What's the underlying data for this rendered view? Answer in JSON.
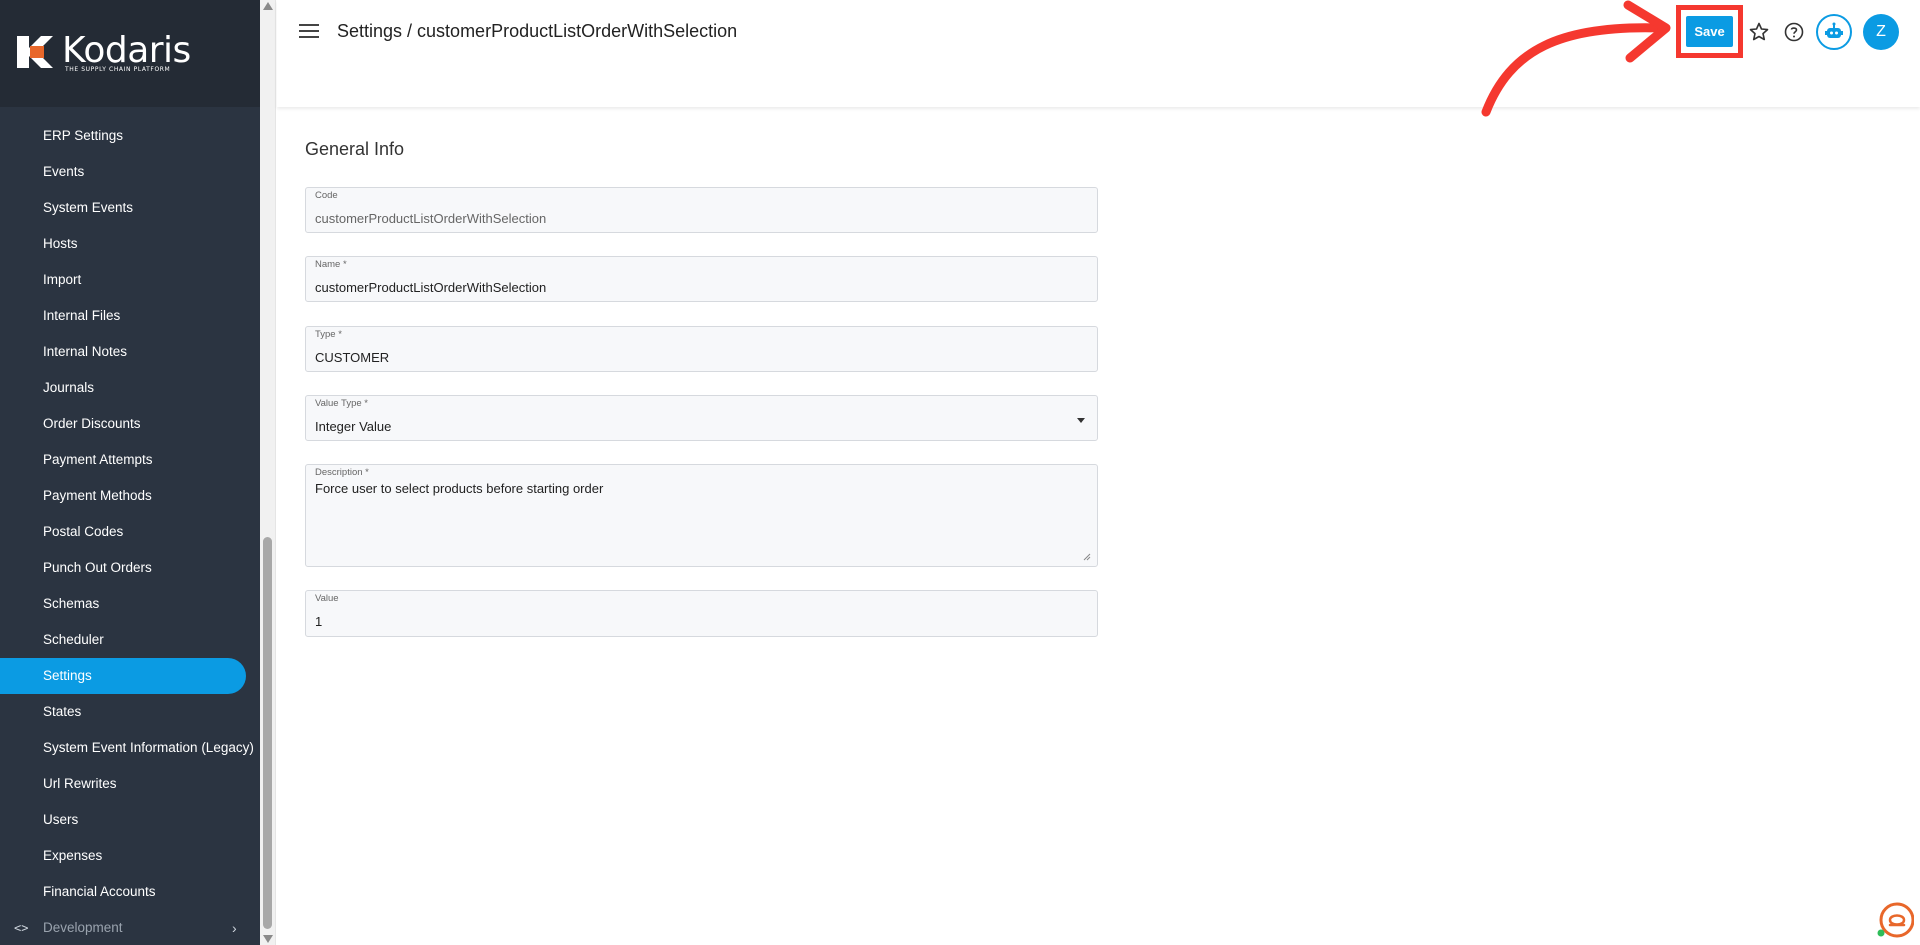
{
  "app": {
    "logo_text": "Kodaris",
    "logo_tagline": "THE SUPPLY CHAIN PLATFORM"
  },
  "sidebar": {
    "items": [
      {
        "label": "ERP Settings"
      },
      {
        "label": "Events"
      },
      {
        "label": "System Events"
      },
      {
        "label": "Hosts"
      },
      {
        "label": "Import"
      },
      {
        "label": "Internal Files"
      },
      {
        "label": "Internal Notes"
      },
      {
        "label": "Journals"
      },
      {
        "label": "Order Discounts"
      },
      {
        "label": "Payment Attempts"
      },
      {
        "label": "Payment Methods"
      },
      {
        "label": "Postal Codes"
      },
      {
        "label": "Punch Out Orders"
      },
      {
        "label": "Schemas"
      },
      {
        "label": "Scheduler"
      },
      {
        "label": "Settings"
      },
      {
        "label": "States"
      },
      {
        "label": "System Event Information (Legacy)"
      },
      {
        "label": "Url Rewrites"
      },
      {
        "label": "Users"
      },
      {
        "label": "Expenses"
      },
      {
        "label": "Financial Accounts"
      }
    ],
    "active_item": "Settings",
    "dev_section": {
      "label": "Development",
      "icon": "code-icon"
    }
  },
  "header": {
    "title": "Settings / customerProductListOrderWithSelection",
    "save_label": "Save",
    "avatar_initial": "Z"
  },
  "form": {
    "section_title": "General Info",
    "code": {
      "label": "Code",
      "value": "customerProductListOrderWithSelection"
    },
    "name": {
      "label": "Name *",
      "value": "customerProductListOrderWithSelection"
    },
    "type": {
      "label": "Type *",
      "value": "CUSTOMER"
    },
    "value_type": {
      "label": "Value Type *",
      "value": "Integer Value"
    },
    "description": {
      "label": "Description *",
      "value": "Force user to select products before starting order"
    },
    "value": {
      "label": "Value",
      "value": "1"
    }
  },
  "colors": {
    "accent": "#0b9be3",
    "sidebar_bg": "#2b3441",
    "annotation": "#f5382f"
  }
}
